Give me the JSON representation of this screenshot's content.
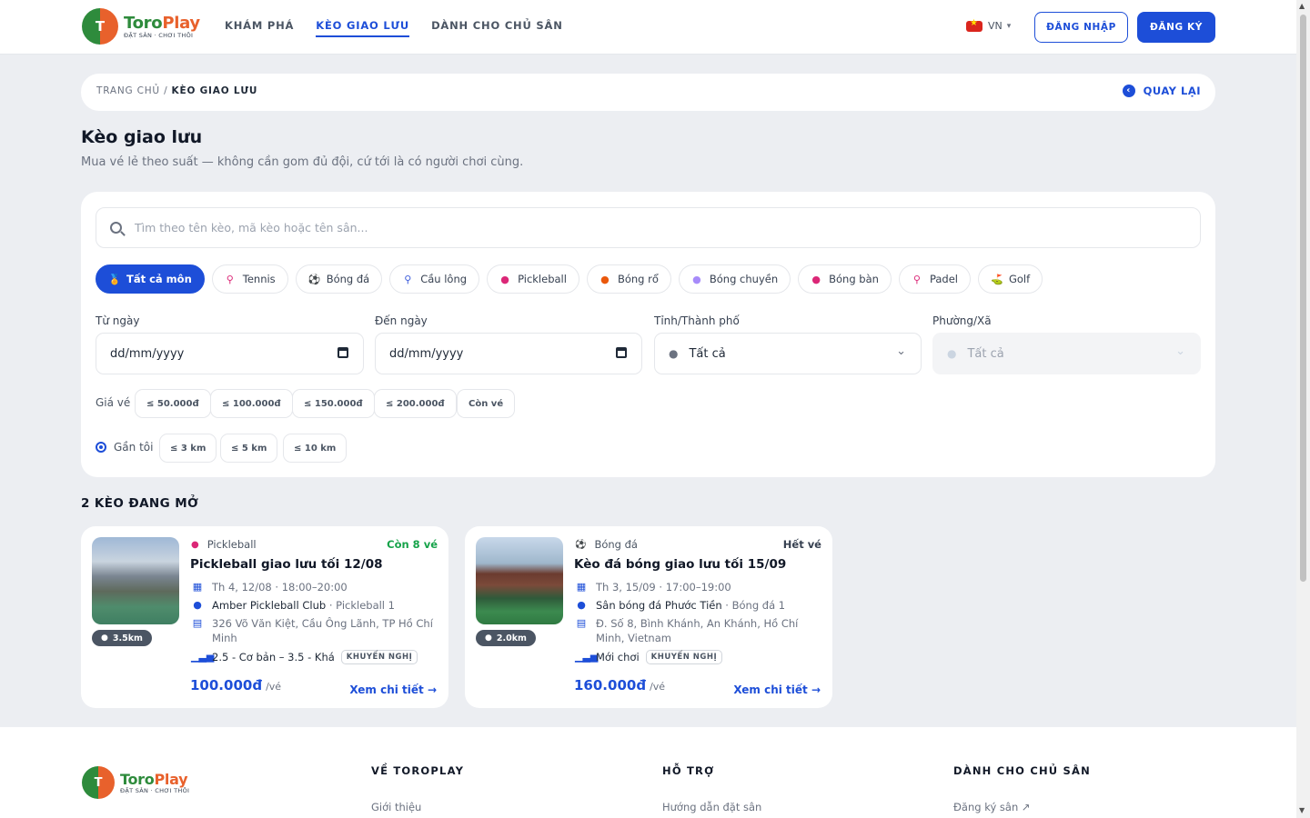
{
  "brand": {
    "name_part1": "Toro",
    "name_part2": "Play",
    "tagline": "ĐẶT SÂN · CHƠI THÔI",
    "mark": "T"
  },
  "nav": [
    {
      "label": "KHÁM PHÁ"
    },
    {
      "label": "KÈO GIAO LƯU",
      "active": true
    },
    {
      "label": "DÀNH CHO CHỦ SÂN"
    }
  ],
  "header": {
    "lang": "VN",
    "login_label": "ĐĂNG NHẬP",
    "register_label": "ĐĂNG KÝ"
  },
  "breadcrumb": {
    "home": "TRANG CHỦ",
    "sep": "/",
    "current": "KÈO GIAO LƯU",
    "back_label": "QUAY LẠI"
  },
  "page": {
    "title": "Kèo giao lưu",
    "subtitle": "Mua vé lẻ theo suất — không cần gom đủ đội, cứ tới là có người chơi cùng."
  },
  "filters": {
    "search_placeholder": "Tìm theo tên kèo, mã kèo hoặc tên sân...",
    "sports": [
      {
        "label": "Tất cả môn",
        "icon": "medal-icon",
        "active": true
      },
      {
        "label": "Tennis",
        "icon": "racket-icon"
      },
      {
        "label": "Bóng đá",
        "icon": "soccer-ball-icon"
      },
      {
        "label": "Cầu lông",
        "icon": "shuttlecock-icon"
      },
      {
        "label": "Pickleball",
        "icon": "paddle-icon"
      },
      {
        "label": "Bóng rổ",
        "icon": "basketball-icon"
      },
      {
        "label": "Bóng chuyền",
        "icon": "volleyball-icon"
      },
      {
        "label": "Bóng bàn",
        "icon": "ping-pong-icon"
      },
      {
        "label": "Padel",
        "icon": "racket-icon"
      },
      {
        "label": "Golf",
        "icon": "golf-icon"
      }
    ],
    "from_label": "Từ ngày",
    "from_value": "dd/mm/yyyy",
    "to_label": "Đến ngày",
    "to_value": "dd/mm/yyyy",
    "city_label": "Tỉnh/Thành phố",
    "city_value": "Tất cả",
    "ward_label": "Phường/Xã",
    "ward_value": "Tất cả",
    "price_label": "Giá vé",
    "prices": [
      "≤ 50.000đ",
      "≤ 100.000đ",
      "≤ 150.000đ",
      "≤ 200.000đ",
      "Còn vé"
    ],
    "near_label": "Gần tôi",
    "distances": [
      "≤ 3 km",
      "≤ 5 km",
      "≤ 10 km"
    ]
  },
  "results": {
    "count_label": "2 KÈO ĐANG MỞ",
    "cards": [
      {
        "sport": "Pickleball",
        "sport_icon": "paddle-icon",
        "availability": "Còn 8 vé",
        "availability_color": "#16a34a",
        "distance": "3.5km",
        "title": "Pickleball giao lưu tối 12/08",
        "time": "Th 4, 12/08 · 18:00–20:00",
        "venue": "Amber Pickleball Club",
        "court": "· Pickleball 1",
        "address": "326 Võ Văn Kiệt, Cầu Ông Lãnh, TP Hồ Chí Minh",
        "level": "2.5 - Cơ bản – 3.5 - Khá",
        "badge": "KHUYẾN NGHỊ",
        "price": "100.000đ",
        "unit": "/vé",
        "detail_label": "Xem chi tiết"
      },
      {
        "sport": "Bóng đá",
        "sport_icon": "soccer-ball-icon",
        "availability": "Hết vé",
        "availability_color": "#374151",
        "distance": "2.0km",
        "title": "Kèo đá bóng giao lưu tối 15/09",
        "time": "Th 3, 15/09 · 17:00–19:00",
        "venue": "Sân bóng đá Phước Tiền",
        "court": "· Bóng đá 1",
        "address": "Đ. Số 8, Bình Khánh, An Khánh, Hồ Chí Minh, Vietnam",
        "level": "Mới chơi",
        "badge": "KHUYẾN NGHỊ",
        "price": "160.000đ",
        "unit": "/vé",
        "detail_label": "Xem chi tiết"
      }
    ]
  },
  "footer": {
    "col1_title": "VỀ TOROPLAY",
    "col1_link": "Giới thiệu",
    "col2_title": "HỖ TRỢ",
    "col2_link": "Hướng dẫn đặt sân",
    "col3_title": "DÀNH CHO CHỦ SÂN",
    "col3_link": "Đăng ký sân"
  }
}
